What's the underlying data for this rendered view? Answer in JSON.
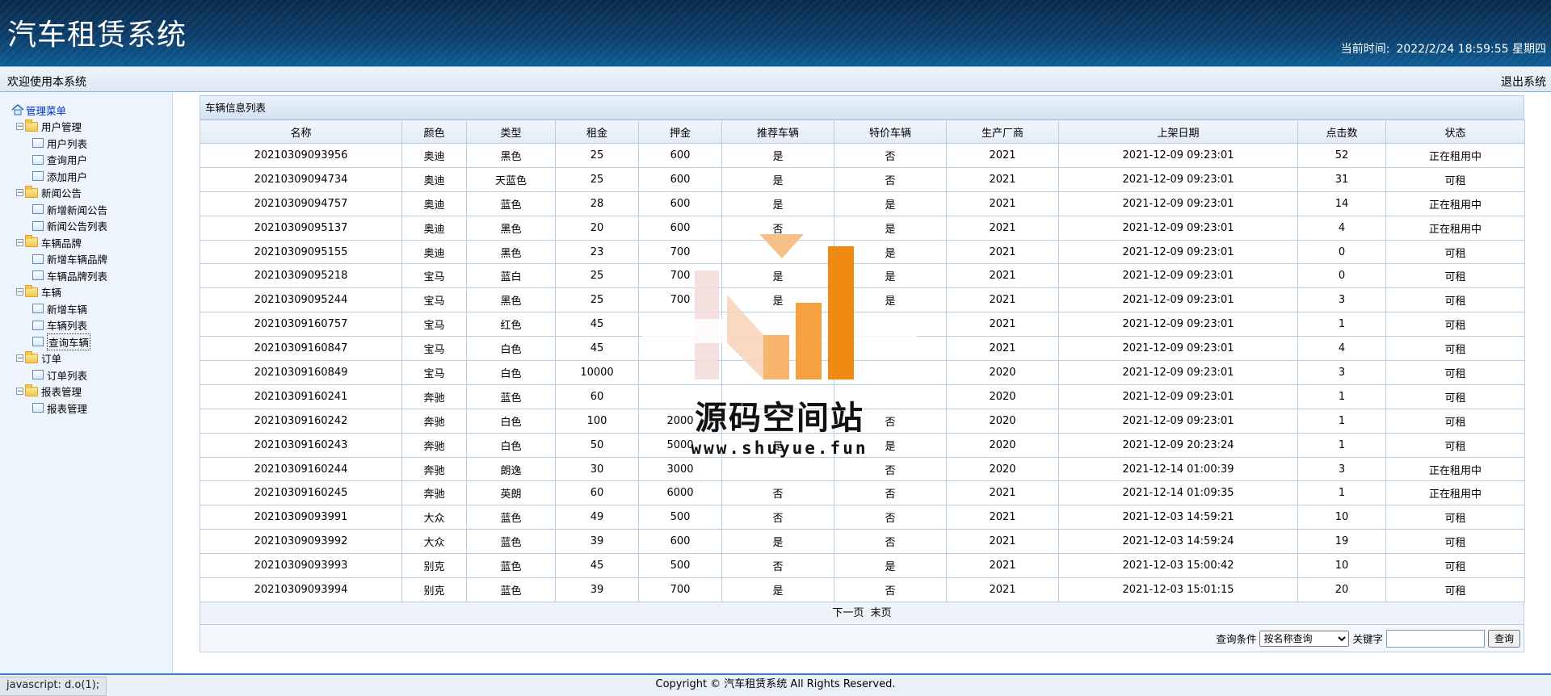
{
  "header": {
    "title": "汽车租赁系统",
    "clock_label": "当前时间:",
    "clock_value": "2022/2/24 18:59:55 星期四"
  },
  "topbar": {
    "welcome": "欢迎使用本系统",
    "logout": "退出系统"
  },
  "sidebar": {
    "root": "管理菜单",
    "groups": [
      {
        "label": "用户管理",
        "items": [
          "用户列表",
          "查询用户",
          "添加用户"
        ]
      },
      {
        "label": "新闻公告",
        "items": [
          "新增新闻公告",
          "新闻公告列表"
        ]
      },
      {
        "label": "车辆品牌",
        "items": [
          "新增车辆品牌",
          "车辆品牌列表"
        ]
      },
      {
        "label": "车辆",
        "items": [
          "新增车辆",
          "车辆列表",
          "查询车辆"
        ]
      },
      {
        "label": "订单",
        "items": [
          "订单列表"
        ]
      },
      {
        "label": "报表管理",
        "items": [
          "报表管理"
        ]
      }
    ],
    "selected": "查询车辆"
  },
  "panel": {
    "title": "车辆信息列表",
    "columns": [
      "名称",
      "颜色",
      "类型",
      "租金",
      "押金",
      "推荐车辆",
      "特价车辆",
      "生产厂商",
      "上架日期",
      "点击数",
      "状态"
    ],
    "rows": [
      [
        "20210309093956",
        "奥迪",
        "黑色",
        "25",
        "600",
        "是",
        "否",
        "2021",
        "2021-12-09 09:23:01",
        "52",
        "正在租用中"
      ],
      [
        "20210309094734",
        "奥迪",
        "天蓝色",
        "25",
        "600",
        "是",
        "否",
        "2021",
        "2021-12-09 09:23:01",
        "31",
        "可租"
      ],
      [
        "20210309094757",
        "奥迪",
        "蓝色",
        "28",
        "600",
        "是",
        "是",
        "2021",
        "2021-12-09 09:23:01",
        "14",
        "正在租用中"
      ],
      [
        "20210309095137",
        "奥迪",
        "黑色",
        "20",
        "600",
        "否",
        "是",
        "2021",
        "2021-12-09 09:23:01",
        "4",
        "正在租用中"
      ],
      [
        "20210309095155",
        "奥迪",
        "黑色",
        "23",
        "700",
        "",
        "是",
        "2021",
        "2021-12-09 09:23:01",
        "0",
        "可租"
      ],
      [
        "20210309095218",
        "宝马",
        "蓝白",
        "25",
        "700",
        "是",
        "是",
        "2021",
        "2021-12-09 09:23:01",
        "0",
        "可租"
      ],
      [
        "20210309095244",
        "宝马",
        "黑色",
        "25",
        "700",
        "是",
        "是",
        "2021",
        "2021-12-09 09:23:01",
        "3",
        "可租"
      ],
      [
        "20210309160757",
        "宝马",
        "红色",
        "45",
        "",
        "",
        "",
        "2021",
        "2021-12-09 09:23:01",
        "1",
        "可租"
      ],
      [
        "20210309160847",
        "宝马",
        "白色",
        "45",
        "",
        "",
        "",
        "2021",
        "2021-12-09 09:23:01",
        "4",
        "可租"
      ],
      [
        "20210309160849",
        "宝马",
        "白色",
        "10000",
        "",
        "",
        "",
        "2020",
        "2021-12-09 09:23:01",
        "3",
        "可租"
      ],
      [
        "20210309160241",
        "奔驰",
        "蓝色",
        "60",
        "",
        "",
        "",
        "2020",
        "2021-12-09 09:23:01",
        "1",
        "可租"
      ],
      [
        "20210309160242",
        "奔驰",
        "白色",
        "100",
        "2000",
        "",
        "否",
        "2020",
        "2021-12-09 09:23:01",
        "1",
        "可租"
      ],
      [
        "20210309160243",
        "奔驰",
        "白色",
        "50",
        "5000",
        "是",
        "是",
        "2020",
        "2021-12-09 20:23:24",
        "1",
        "可租"
      ],
      [
        "20210309160244",
        "奔驰",
        "朗逸",
        "30",
        "3000",
        "",
        "否",
        "2020",
        "2021-12-14 01:00:39",
        "3",
        "正在租用中"
      ],
      [
        "20210309160245",
        "奔驰",
        "英朗",
        "60",
        "6000",
        "否",
        "否",
        "2021",
        "2021-12-14 01:09:35",
        "1",
        "正在租用中"
      ],
      [
        "20210309093991",
        "大众",
        "蓝色",
        "49",
        "500",
        "否",
        "否",
        "2021",
        "2021-12-03 14:59:21",
        "10",
        "可租"
      ],
      [
        "20210309093992",
        "大众",
        "蓝色",
        "39",
        "600",
        "是",
        "否",
        "2021",
        "2021-12-03 14:59:24",
        "19",
        "可租"
      ],
      [
        "20210309093993",
        "别克",
        "蓝色",
        "45",
        "500",
        "否",
        "是",
        "2021",
        "2021-12-03 15:00:42",
        "10",
        "可租"
      ],
      [
        "20210309093994",
        "别克",
        "蓝色",
        "39",
        "700",
        "是",
        "否",
        "2021",
        "2021-12-03 15:01:15",
        "20",
        "可租"
      ]
    ]
  },
  "pager": {
    "next": "下一页",
    "last": "末页"
  },
  "search": {
    "condition_label": "查询条件",
    "condition_value": "按名称查询",
    "keyword_label": "关键字",
    "keyword_value": "",
    "submit": "查询"
  },
  "footer": {
    "copyright": "Copyright © 汽车租赁系统 All Rights Reserved."
  },
  "statusbar": {
    "text": "javascript: d.o(1);"
  },
  "watermark": {
    "text": "源码空间站",
    "url": "www.shuyue.fun"
  },
  "colors": {
    "header_dark": "#0a2a4a",
    "header_light": "#0e5d94",
    "border": "#b9cde5",
    "footer_line": "#3a7bc8",
    "watermark_orange": "#f7941d"
  }
}
